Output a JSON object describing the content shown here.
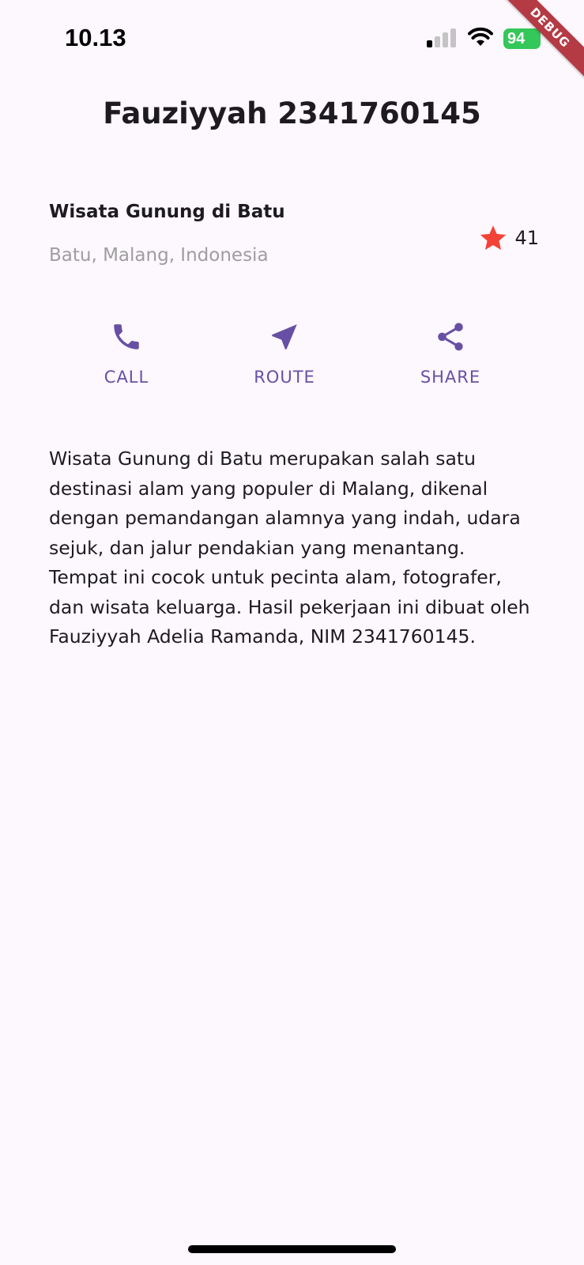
{
  "status_bar": {
    "time": "10.13",
    "battery": "94"
  },
  "debug_banner": "DEBUG",
  "app_bar": {
    "title": "Fauziyyah 2341760145"
  },
  "title_section": {
    "name": "Wisata Gunung di Batu",
    "location": "Batu, Malang, Indonesia",
    "rating_count": "41",
    "star_color": "#F44336"
  },
  "buttons": {
    "call": {
      "label": "CALL",
      "icon": "phone-icon"
    },
    "route": {
      "label": "ROUTE",
      "icon": "near-me-icon"
    },
    "share": {
      "label": "SHARE",
      "icon": "share-icon"
    },
    "accent_color": "#6750A4"
  },
  "description": "Wisata Gunung di Batu merupakan salah satu destinasi alam yang populer di Malang, dikenal dengan pemandangan alamnya yang indah, udara sejuk, dan jalur pendakian yang menantang. Tempat ini cocok untuk pecinta alam, fotografer, dan wisata keluarga. Hasil pekerjaan ini dibuat oleh Fauziyyah Adelia Ramanda, NIM 2341760145."
}
